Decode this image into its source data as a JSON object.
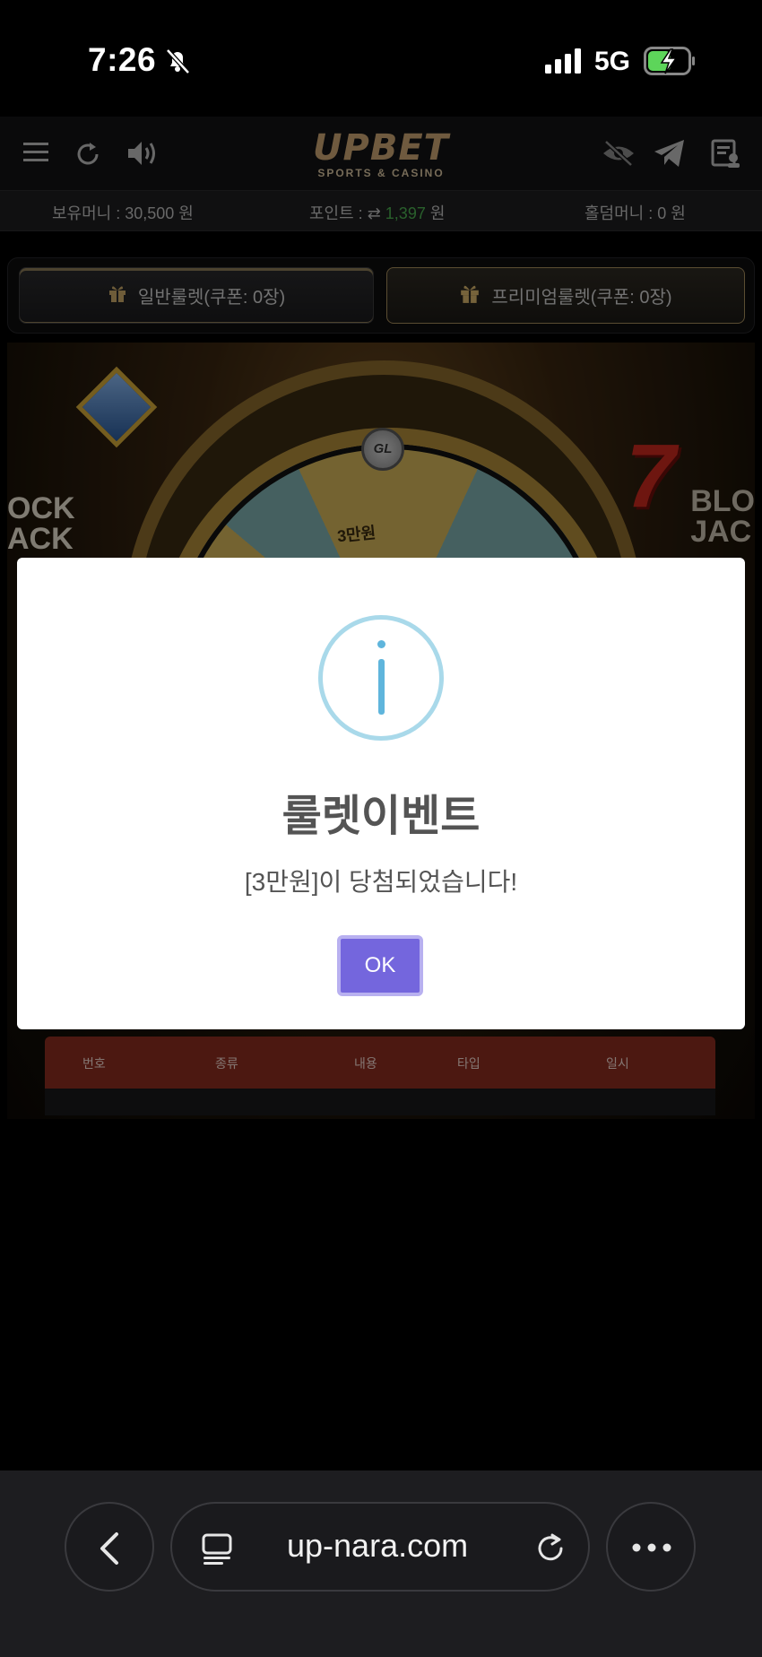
{
  "status_bar": {
    "time": "7:26",
    "network": "5G"
  },
  "header": {
    "logo_main": "UPBET",
    "logo_sub": "SPORTS & CASINO"
  },
  "money_bar": {
    "balance": "보유머니 : 30,500 원",
    "points_label": "포인트 : ",
    "points_value": "1,397",
    "points_unit": " 원",
    "holdem": "홀덤머니 : 0 원"
  },
  "tabs": [
    {
      "label": "일반룰렛(쿠폰: 0장)"
    },
    {
      "label": "프리미엄룰렛(쿠폰: 0장)"
    }
  ],
  "game": {
    "pin_label": "GL",
    "wheel_label": "3만원"
  },
  "table": {
    "headers": [
      "번호",
      "종류",
      "내용",
      "타입",
      "일시"
    ]
  },
  "modal": {
    "title": "룰렛이벤트",
    "message": "[3만원]이 당첨되었습니다!",
    "ok_label": "OK"
  },
  "browser": {
    "url": "up-nara.com"
  },
  "colors": {
    "ok_button": "#7466dd",
    "info_icon": "#5fb5dc",
    "points_green": "#4caf50",
    "table_header": "#8a2c20"
  }
}
